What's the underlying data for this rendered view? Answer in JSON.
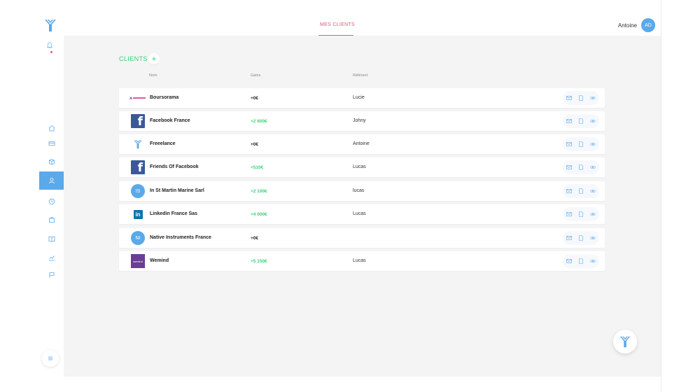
{
  "header": {
    "tab_label": "MES CLIENTS",
    "user_name": "Antoine",
    "avatar_initials": "AD"
  },
  "clients": {
    "title": "CLIENTS",
    "add_label": "+",
    "columns": {
      "name": "Nom",
      "gains": "Gains",
      "referent": "Référent"
    },
    "rows": [
      {
        "name": "Boursorama",
        "gain": "+0€",
        "gain_color": "#222222",
        "referent": "Lucie",
        "logo": "boursorama-logo"
      },
      {
        "name": "Facebook France",
        "gain": "+2 600€",
        "gain_color": "#3ecf74",
        "referent": "Johny",
        "logo": "facebook-logo"
      },
      {
        "name": "Freeelance",
        "gain": "+0€",
        "gain_color": "#222222",
        "referent": "Antoine",
        "logo": "freeelance-logo"
      },
      {
        "name": "Friends Of Facebook",
        "gain": "+510€",
        "gain_color": "#3ecf74",
        "referent": "Lucas",
        "logo": "facebook-logo"
      },
      {
        "name": "In St Martin Marine Sarl",
        "gain": "+2 100€",
        "gain_color": "#3ecf74",
        "referent": "lucas",
        "logo": "initials-logo",
        "initials": "IS"
      },
      {
        "name": "Linkedin France Sas",
        "gain": "+4 000€",
        "gain_color": "#3ecf74",
        "referent": "Lucas",
        "logo": "linkedin-logo"
      },
      {
        "name": "Native Instruments France",
        "gain": "+0€",
        "gain_color": "#222222",
        "referent": "",
        "logo": "initials-logo",
        "initials": "NI"
      },
      {
        "name": "Wemind",
        "gain": "+5 150€",
        "gain_color": "#3ecf74",
        "referent": "Lucas",
        "logo": "wemind-logo"
      }
    ]
  },
  "colors": {
    "accent_blue": "#5aa9ea",
    "accent_green": "#3ecf74",
    "accent_pink": "#e05a7a",
    "background": "#f4f4f4"
  },
  "sidebar": {
    "items": [
      {
        "icon": "home-icon"
      },
      {
        "icon": "credit-card-icon"
      },
      {
        "icon": "box-icon"
      },
      {
        "icon": "user-icon",
        "active": true
      },
      {
        "icon": "clock-icon"
      },
      {
        "icon": "briefcase-icon"
      },
      {
        "icon": "book-icon"
      },
      {
        "icon": "chart-icon"
      },
      {
        "icon": "flag-icon"
      }
    ]
  }
}
